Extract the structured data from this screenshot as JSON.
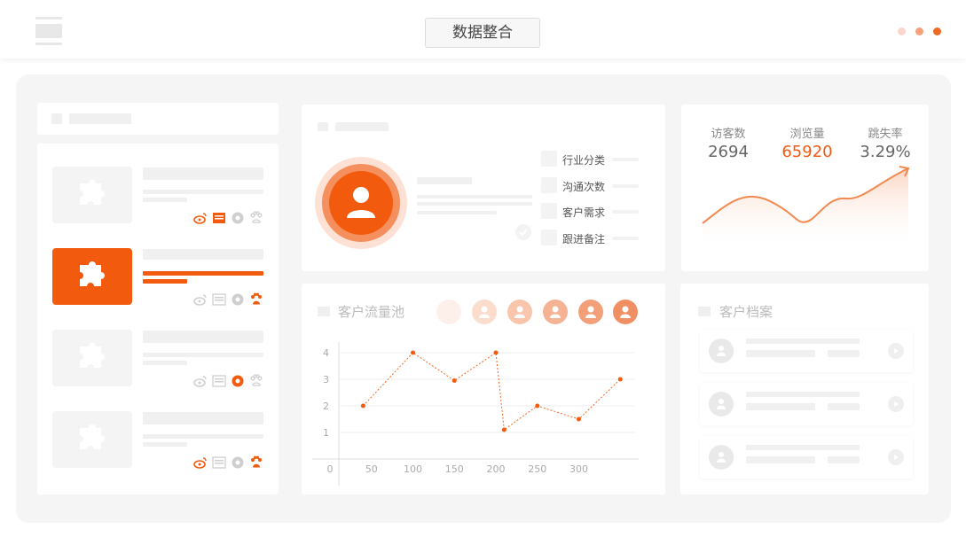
{
  "header": {
    "title": "数据整合",
    "dot_colors": [
      "#fbd6cc",
      "#f5a27c",
      "#f06a24"
    ]
  },
  "profile": {
    "legend": [
      "行业分类",
      "沟通次数",
      "客户需求",
      "跟进备注"
    ]
  },
  "stats": {
    "items": [
      {
        "label": "访客数",
        "value": "2694",
        "color": "#666666"
      },
      {
        "label": "浏览量",
        "value": "65920",
        "color": "#f05a14"
      },
      {
        "label": "跳失率",
        "value": "3.29%",
        "color": "#666666"
      }
    ]
  },
  "pool": {
    "title": "客户流量池"
  },
  "archive": {
    "title": "客户档案"
  },
  "chart_data": {
    "type": "line",
    "x_tick_labels": [
      "0",
      "50",
      "100",
      "150",
      "200",
      "250",
      "300"
    ],
    "y_tick_labels": [
      "1",
      "2",
      "3",
      "4"
    ],
    "ylim": [
      0,
      4
    ],
    "series": [
      {
        "x": [
          40,
          100,
          150,
          200,
          210,
          250,
          300,
          350
        ],
        "y": [
          2.0,
          4.0,
          2.95,
          4.0,
          1.1,
          2.0,
          1.5,
          3.0
        ]
      }
    ],
    "grid": true,
    "color": "#f06a24"
  },
  "colors": {
    "accent": "#f25a0d",
    "accent_light": "#f5a27c"
  }
}
